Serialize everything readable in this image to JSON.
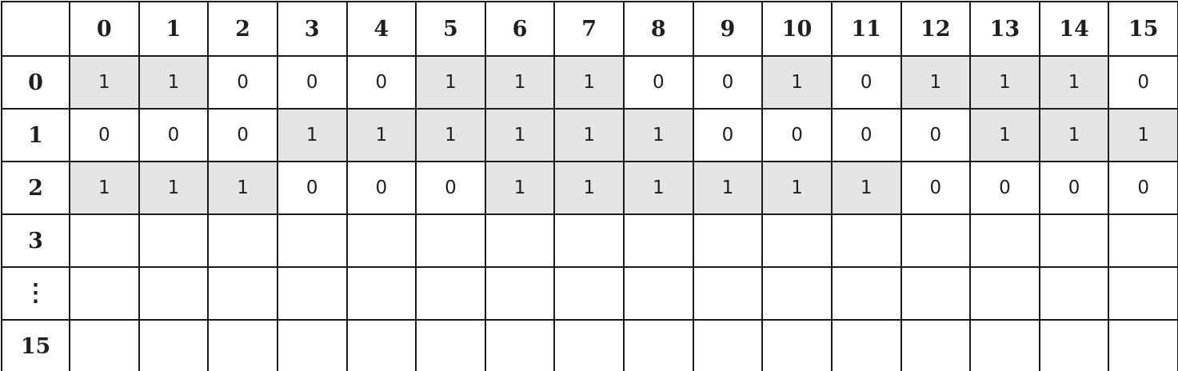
{
  "table": {
    "corner_label": "",
    "column_labels": [
      "0",
      "1",
      "2",
      "3",
      "4",
      "5",
      "6",
      "7",
      "8",
      "9",
      "10",
      "11",
      "12",
      "13",
      "14",
      "15"
    ],
    "rows": [
      {
        "label": "0",
        "cells": [
          "1",
          "1",
          "0",
          "0",
          "0",
          "1",
          "1",
          "1",
          "0",
          "0",
          "1",
          "0",
          "1",
          "1",
          "1",
          "0"
        ]
      },
      {
        "label": "1",
        "cells": [
          "0",
          "0",
          "0",
          "1",
          "1",
          "1",
          "1",
          "1",
          "1",
          "0",
          "0",
          "0",
          "0",
          "1",
          "1",
          "1"
        ]
      },
      {
        "label": "2",
        "cells": [
          "1",
          "1",
          "1",
          "0",
          "0",
          "0",
          "1",
          "1",
          "1",
          "1",
          "1",
          "1",
          "0",
          "0",
          "0",
          "0"
        ]
      },
      {
        "label": "3",
        "cells": [
          "",
          "",
          "",
          "",
          "",
          "",
          "",
          "",
          "",
          "",
          "",
          "",
          "",
          "",
          "",
          ""
        ]
      },
      {
        "label": "⋮",
        "cells": [
          "",
          "",
          "",
          "",
          "",
          "",
          "",
          "",
          "",
          "",
          "",
          "",
          "",
          "",
          "",
          ""
        ]
      },
      {
        "label": "15",
        "cells": [
          "",
          "",
          "",
          "",
          "",
          "",
          "",
          "",
          "",
          "",
          "",
          "",
          "",
          "",
          "",
          ""
        ]
      }
    ],
    "highlight_value": "1",
    "highlight_color": "#e4e4e4"
  }
}
